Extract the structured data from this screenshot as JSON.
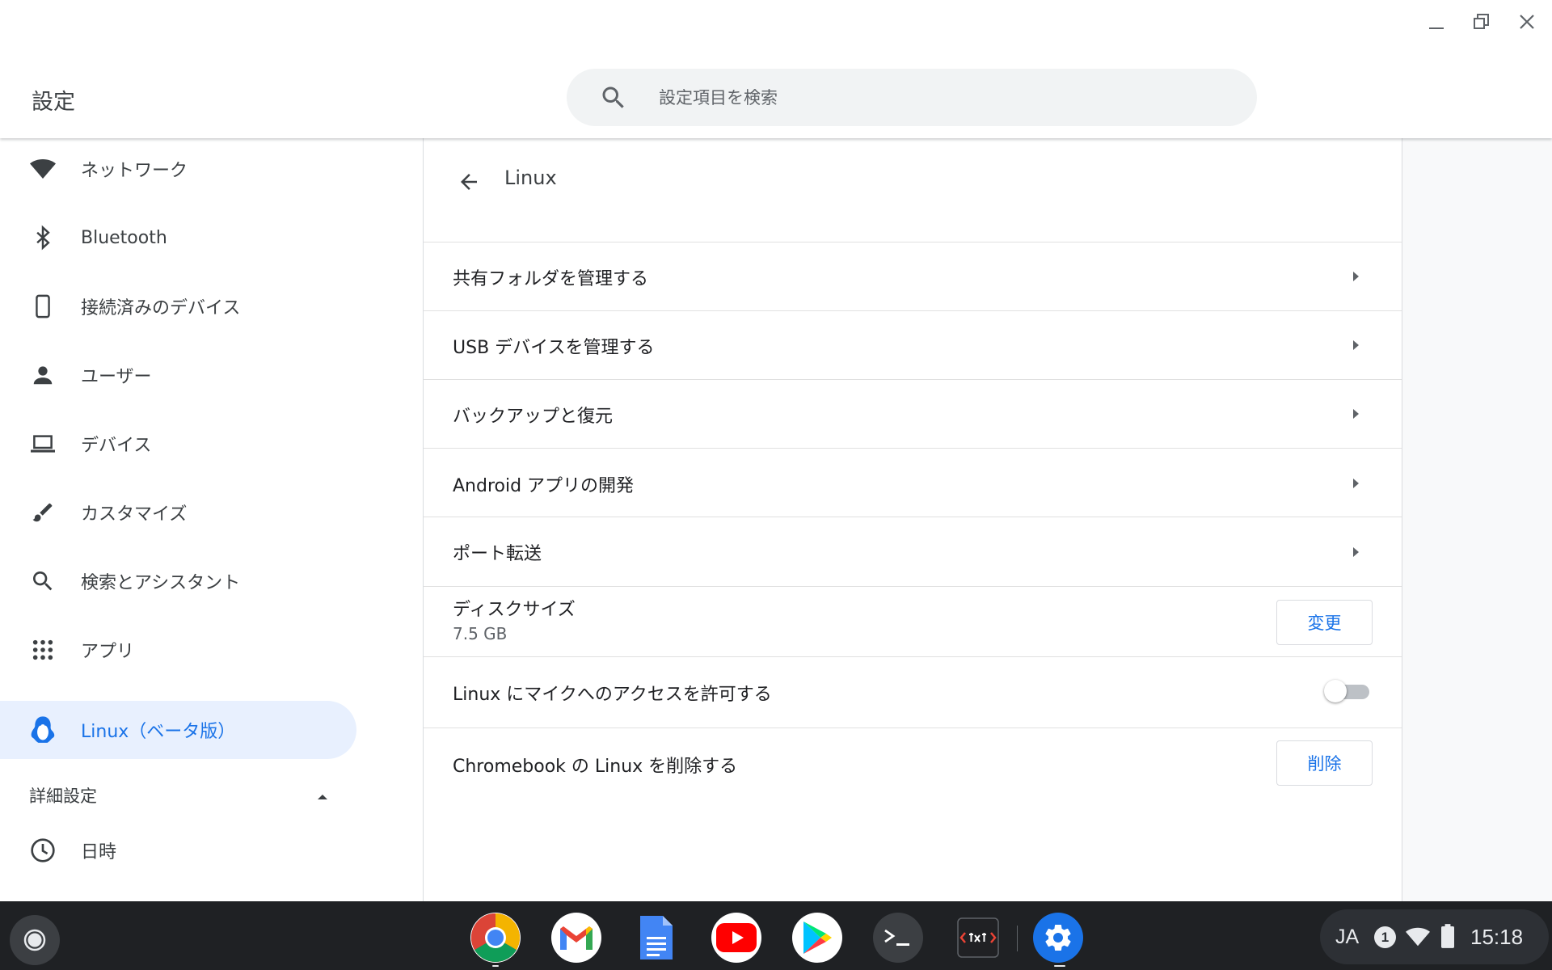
{
  "window": {
    "app_title": "設定"
  },
  "search": {
    "placeholder": "設定項目を検索"
  },
  "sidebar": {
    "items": [
      {
        "label": "ネットワーク",
        "icon": "wifi-icon"
      },
      {
        "label": "Bluetooth",
        "icon": "bluetooth-icon"
      },
      {
        "label": "接続済みのデバイス",
        "icon": "phone-icon"
      },
      {
        "label": "ユーザー",
        "icon": "person-icon"
      },
      {
        "label": "デバイス",
        "icon": "laptop-icon"
      },
      {
        "label": "カスタマイズ",
        "icon": "brush-icon"
      },
      {
        "label": "検索とアシスタント",
        "icon": "search-icon"
      },
      {
        "label": "アプリ",
        "icon": "apps-grid-icon"
      },
      {
        "label": "Linux（ベータ版）",
        "icon": "penguin-icon",
        "active": true
      }
    ],
    "advanced_label": "詳細設定",
    "datetime_label": "日時"
  },
  "main": {
    "title": "Linux",
    "rows": {
      "shared_folders": "共有フォルダを管理する",
      "usb_devices": "USB デバイスを管理する",
      "backup_restore": "バックアップと復元",
      "android_dev": "Android アプリの開発",
      "port_forwarding": "ポート転送",
      "disk_size_label": "ディスクサイズ",
      "disk_size_value": "7.5 GB",
      "disk_change_button": "変更",
      "mic_access_label": "Linux にマイクへのアクセスを許可する",
      "mic_access_enabled": false,
      "remove_label": "Chromebook の Linux を削除する",
      "remove_button": "削除"
    }
  },
  "shelf": {
    "apps": [
      "chrome-icon",
      "gmail-icon",
      "docs-icon",
      "youtube-icon",
      "play-store-icon",
      "terminal-icon",
      "text-editor-icon",
      "settings-icon"
    ],
    "tray": {
      "ime": "JA",
      "notification_count": "1",
      "time": "15:18"
    }
  },
  "colors": {
    "accent": "#1a73e8",
    "active_bg": "#e8f0fe",
    "shelf_bg": "#1f2124"
  }
}
